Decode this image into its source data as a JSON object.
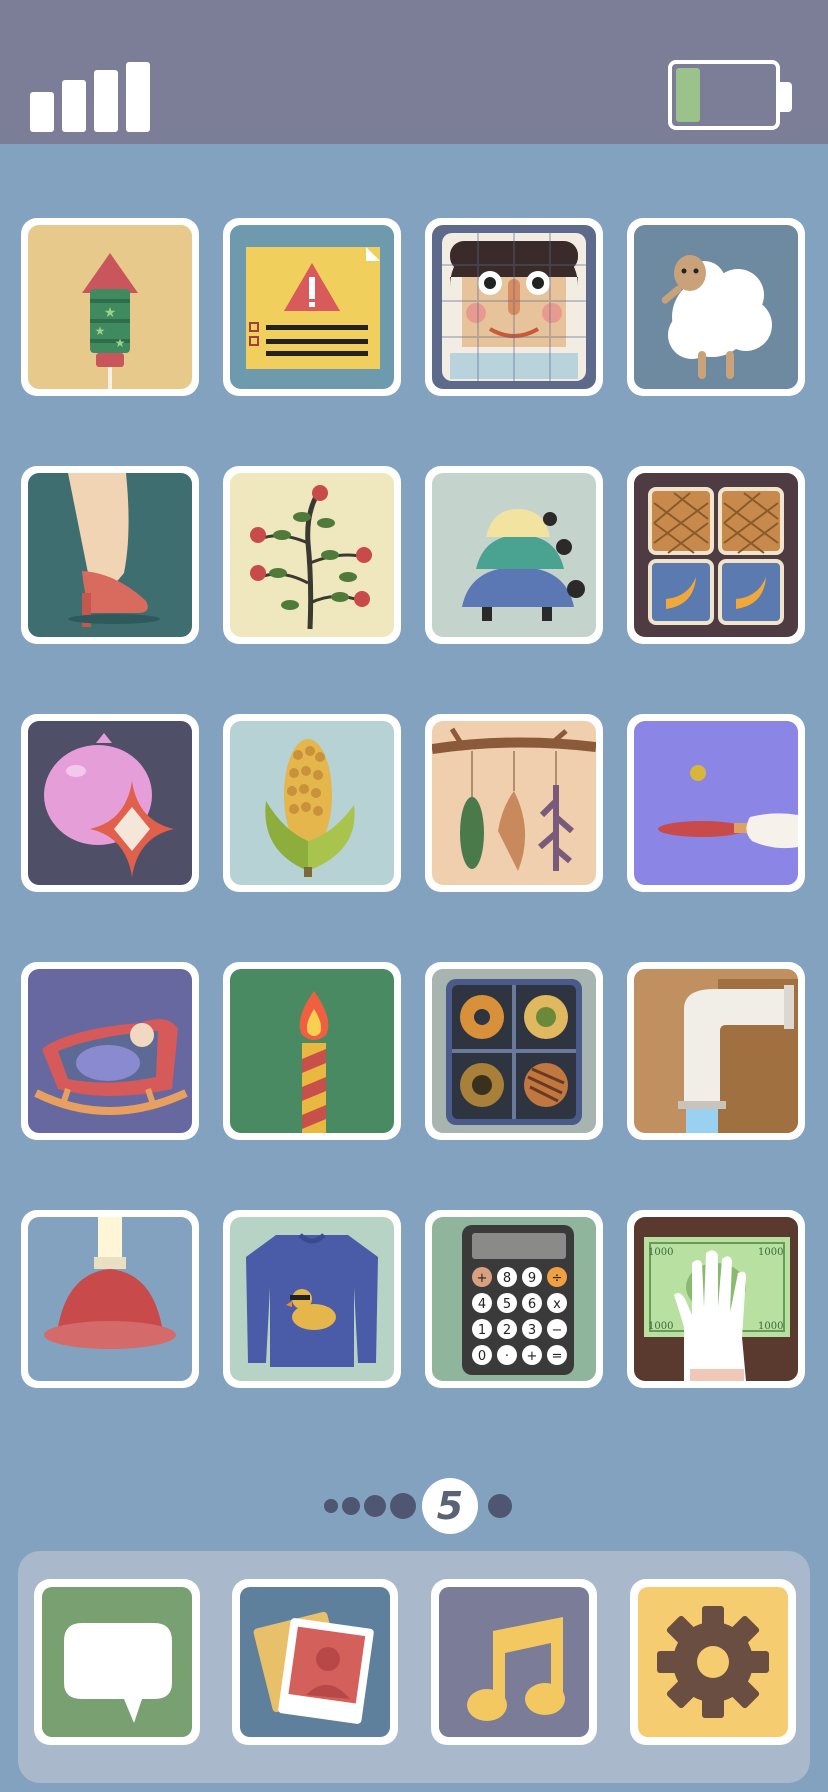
{
  "status_bar": {
    "signal_bars": 4,
    "battery_level": 0.25,
    "battery_color": "#9cc28c"
  },
  "home_grid": {
    "page_indicator": {
      "current_page_label": "5",
      "pages_before": 4,
      "pages_after": 1
    },
    "apps": [
      {
        "icon": "firework-rocket-icon",
        "bg": "#e8c98c"
      },
      {
        "icon": "warning-document-icon",
        "bg": "#6e9aae"
      },
      {
        "icon": "face-puzzle-icon",
        "bg": "#5e6a8c"
      },
      {
        "icon": "sheep-icon",
        "bg": "#6e8aa0"
      },
      {
        "icon": "high-heel-leg-icon",
        "bg": "#3e6e70"
      },
      {
        "icon": "flowering-branch-icon",
        "bg": "#efe7bd"
      },
      {
        "icon": "stacked-turtles-icon",
        "bg": "#c5d3cd"
      },
      {
        "icon": "slot-machine-bananas-icon",
        "bg": "#4e3c42"
      },
      {
        "icon": "balloon-sparkle-icon",
        "bg": "#4f4f68"
      },
      {
        "icon": "corn-icon",
        "bg": "#b6d2d4"
      },
      {
        "icon": "hanging-specimens-icon",
        "bg": "#efcfad"
      },
      {
        "icon": "ping-pong-paddle-icon",
        "bg": "#8b86e6"
      },
      {
        "icon": "rocking-cradle-icon",
        "bg": "#6868a0"
      },
      {
        "icon": "candle-icon",
        "bg": "#4a8a62"
      },
      {
        "icon": "cookie-box-icon",
        "bg": "#a7b4b0"
      },
      {
        "icon": "faucet-pipe-icon",
        "bg": "#c09060"
      },
      {
        "icon": "plunger-icon",
        "bg": "#82a2c0"
      },
      {
        "icon": "duck-sweater-icon",
        "bg": "#b7d3c6"
      },
      {
        "icon": "calculator-icon",
        "bg": "#8fb59c"
      },
      {
        "icon": "gloved-hand-banknote-icon",
        "bg": "#5a3a2e"
      }
    ],
    "calculator_keys": [
      "+",
      "8",
      "9",
      "÷",
      "4",
      "5",
      "6",
      "x",
      "1",
      "2",
      "3",
      "−",
      "0",
      "·",
      "+",
      "="
    ],
    "banknote_text": "1000"
  },
  "dock": {
    "apps": [
      {
        "icon": "speech-bubble-icon",
        "bg": "#78a070"
      },
      {
        "icon": "photos-icon",
        "bg": "#5e809c"
      },
      {
        "icon": "music-note-icon",
        "bg": "#7a7c98"
      },
      {
        "icon": "gear-icon",
        "bg": "#f6cc70"
      }
    ]
  }
}
